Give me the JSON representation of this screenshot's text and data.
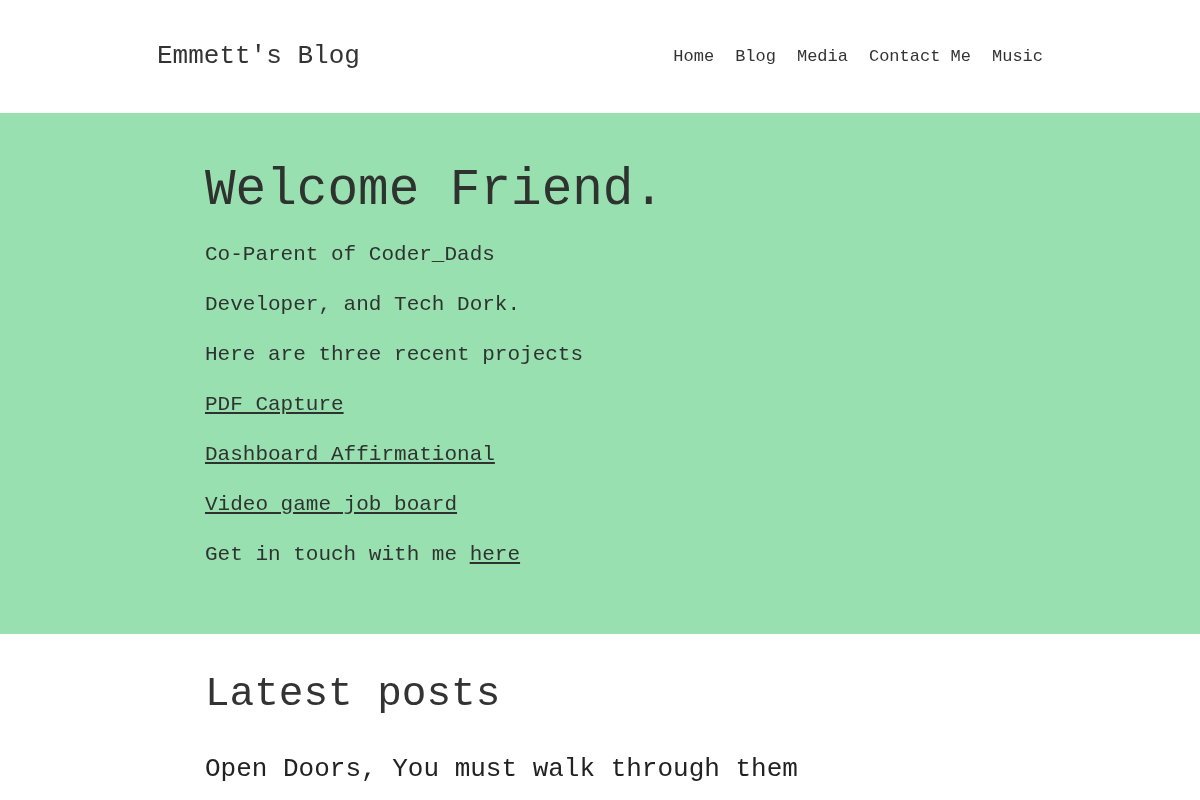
{
  "header": {
    "site_title": "Emmett's Blog",
    "nav": [
      "Home",
      "Blog",
      "Media",
      "Contact Me",
      "Music"
    ]
  },
  "hero": {
    "heading": "Welcome Friend.",
    "lines": [
      {
        "kind": "text",
        "text": "Co-Parent of Coder_Dads"
      },
      {
        "kind": "text",
        "text": "Developer, and Tech Dork."
      },
      {
        "kind": "text",
        "text": "Here are three recent projects"
      },
      {
        "kind": "link",
        "text": "PDF Capture"
      },
      {
        "kind": "link",
        "text": "Dashboard Affirmational"
      },
      {
        "kind": "link",
        "text": "Video game job board"
      },
      {
        "kind": "text_with_link",
        "text": "Get in touch with me",
        "link": "here"
      }
    ]
  },
  "latest": {
    "heading": "Latest posts",
    "posts": [
      {
        "title": "Open Doors, You must walk through them"
      }
    ]
  }
}
